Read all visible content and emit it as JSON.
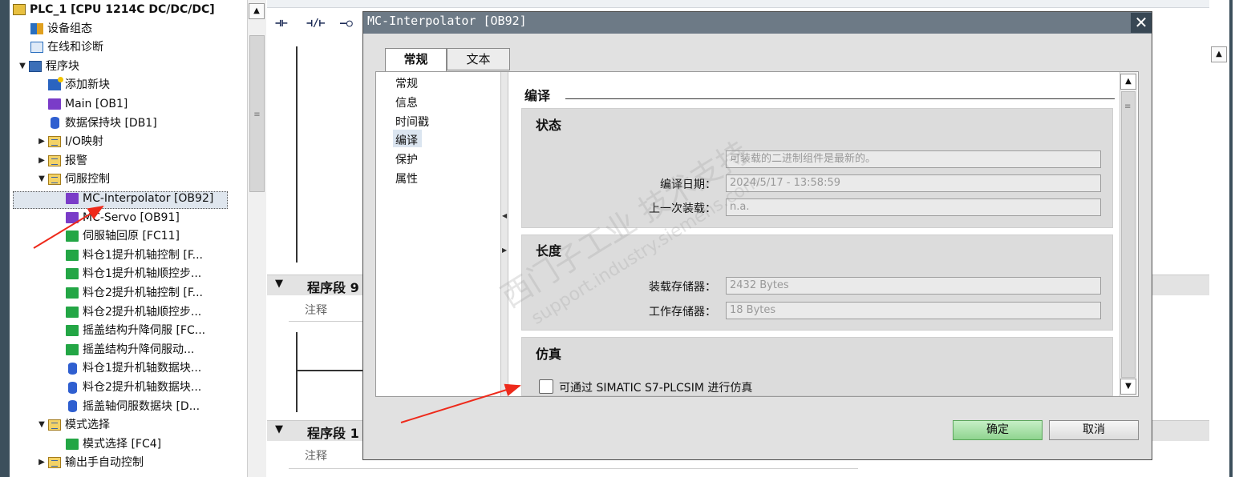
{
  "tree": {
    "items": [
      {
        "label": "PLC_1 [CPU 1214C DC/DC/DC]",
        "icon": "plc-icon"
      },
      {
        "label": "设备组态",
        "icon": "device-config-icon"
      },
      {
        "label": "在线和诊断",
        "icon": "online-diagnostics-icon"
      },
      {
        "label": "程序块",
        "icon": "program-blocks-folder-icon",
        "expander": "▼"
      },
      {
        "label": "添加新块",
        "icon": "add-block-icon"
      },
      {
        "label": "Main [OB1]",
        "icon": "ob-block-icon"
      },
      {
        "label": "数据保持块 [DB1]",
        "icon": "db-block-icon"
      },
      {
        "label": "I/O映射",
        "icon": "folder-icon",
        "expander": "▶"
      },
      {
        "label": "报警",
        "icon": "folder-icon",
        "expander": "▶"
      },
      {
        "label": "伺服控制",
        "icon": "folder-icon",
        "expander": "▼"
      },
      {
        "label": "MC-Interpolator [OB92]",
        "icon": "ob-block-icon"
      },
      {
        "label": "MC-Servo [OB91]",
        "icon": "ob-block-icon"
      },
      {
        "label": "伺服轴回原 [FC11]",
        "icon": "fc-block-icon"
      },
      {
        "label": "料仓1提升机轴控制 [F...",
        "icon": "fc-block-icon"
      },
      {
        "label": "料仓1提升机轴顺控步...",
        "icon": "fc-block-icon"
      },
      {
        "label": "料仓2提升机轴控制 [F...",
        "icon": "fc-block-icon"
      },
      {
        "label": "料仓2提升机轴顺控步...",
        "icon": "fc-block-icon"
      },
      {
        "label": "摇盖结构升降伺服 [FC...",
        "icon": "fc-block-icon"
      },
      {
        "label": "摇盖结构升降伺服动...",
        "icon": "fc-block-icon"
      },
      {
        "label": "料仓1提升机轴数据块...",
        "icon": "db-block-icon"
      },
      {
        "label": "料仓2提升机轴数据块...",
        "icon": "db-block-icon"
      },
      {
        "label": "摇盖轴伺服数据块 [D...",
        "icon": "db-block-icon"
      },
      {
        "label": "模式选择",
        "icon": "folder-icon",
        "expander": "▼"
      },
      {
        "label": "模式选择 [FC4]",
        "icon": "fc-block-icon"
      },
      {
        "label": "输出手自动控制",
        "icon": "folder-icon",
        "expander": "▶"
      }
    ]
  },
  "editor": {
    "tools": [
      "⊣⊢",
      "⊣/⊢",
      "–○"
    ],
    "segments": [
      {
        "title": "程序段 9",
        "comment": "注释"
      },
      {
        "title": "程序段 1",
        "comment": "注释"
      }
    ]
  },
  "dialog": {
    "title": "MC-Interpolator [OB92]",
    "close": "✕",
    "tabs": [
      "常规",
      "文本"
    ],
    "nav": [
      "常规",
      "信息",
      "时间戳",
      "编译",
      "保护",
      "属性"
    ],
    "compile_title": "编译",
    "status": {
      "title": "状态",
      "message": "可装载的二进制组件是最新的。",
      "compile_date_label": "编译日期：",
      "compile_date": "2024/5/17 - 13:58:59",
      "last_load_label": "上一次装载：",
      "last_load": "n.a."
    },
    "length": {
      "title": "长度",
      "load_mem_label": "装载存储器：",
      "load_mem": "2432 Bytes",
      "work_mem_label": "工作存储器：",
      "work_mem": "18 Bytes"
    },
    "simulation": {
      "title": "仿真",
      "checkbox_label": "可通过 SIMATIC S7-PLCSIM 进行仿真",
      "checked": false
    },
    "ok": "确定",
    "cancel": "取消"
  },
  "watermark": {
    "line1": "西门子工业 技术支持",
    "line2": "support.industry.siemens.com"
  },
  "colors": {
    "ok_button": "#8fd48f",
    "title_bar": "#6d7a86",
    "arrow": "#ee2a1b"
  }
}
